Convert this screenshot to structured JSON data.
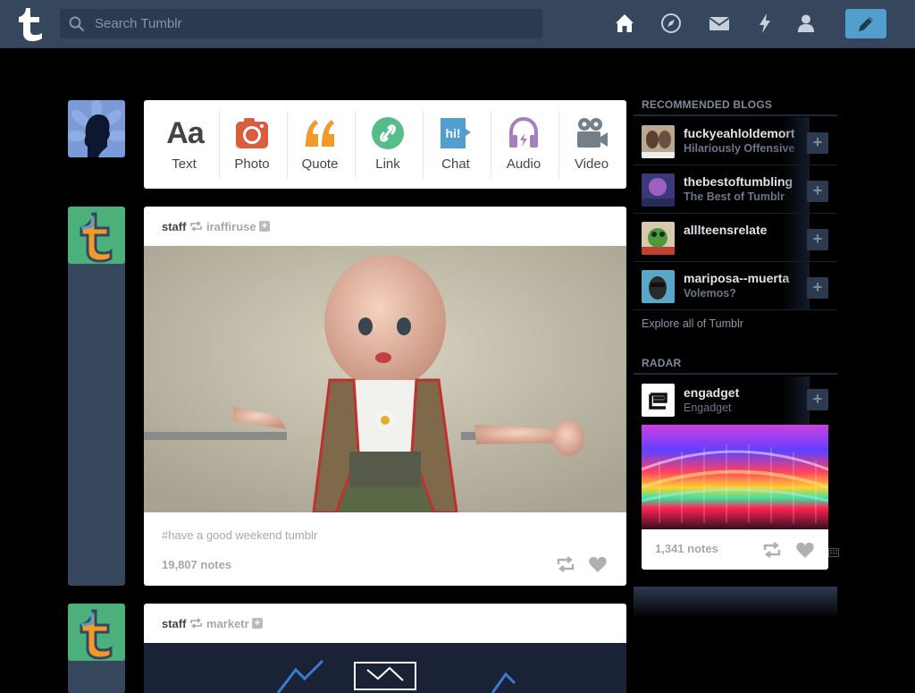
{
  "header": {
    "search_placeholder": "Search Tumblr",
    "nav_icons": [
      "home-icon",
      "explore-icon",
      "inbox-icon",
      "activity-icon",
      "account-icon"
    ],
    "compose_icon": "pencil-icon",
    "bg_color": "#36465d",
    "accent_color": "#529ecc"
  },
  "post_types": [
    {
      "label": "Text",
      "icon": "text-icon",
      "color": "#444444"
    },
    {
      "label": "Photo",
      "icon": "photo-icon",
      "color": "#d95e40"
    },
    {
      "label": "Quote",
      "icon": "quote-icon",
      "color": "#f2992e"
    },
    {
      "label": "Link",
      "icon": "link-icon",
      "color": "#56bc8a"
    },
    {
      "label": "Chat",
      "icon": "chat-icon",
      "color": "#529ecc"
    },
    {
      "label": "Audio",
      "icon": "audio-icon",
      "color": "#a77dc2"
    },
    {
      "label": "Video",
      "icon": "video-icon",
      "color": "#748089"
    }
  ],
  "posts": [
    {
      "user": "staff",
      "source": "iraffiruse",
      "tag": "#have a good weekend tumblr",
      "notes": "19,807 notes"
    },
    {
      "user": "staff",
      "source": "marketr"
    }
  ],
  "sidebar": {
    "recommended_title": "RECOMMENDED BLOGS",
    "blogs": [
      {
        "name": "fuckyeahloldemort",
        "subtitle": "Hilariously Offensive"
      },
      {
        "name": "thebestoftumbling",
        "subtitle": "The Best of Tumblr"
      },
      {
        "name": "alllteensrelate",
        "subtitle": ""
      },
      {
        "name": "mariposa--muerta",
        "subtitle": "Volemos?"
      }
    ],
    "explore_label": "Explore all of Tumblr",
    "radar_title": "RADAR",
    "radar": {
      "name": "engadget",
      "subtitle": "Engadget",
      "notes": "1,341 notes"
    }
  }
}
